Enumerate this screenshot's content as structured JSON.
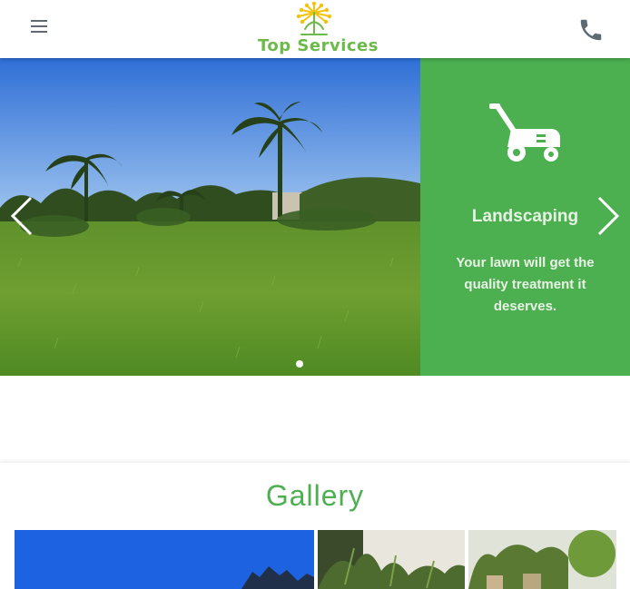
{
  "header": {
    "menu_icon": "hamburger-menu-icon",
    "phone_icon": "phone-icon",
    "logo_text": "Top Services"
  },
  "hero": {
    "slide": {
      "icon": "lawn-mower-icon",
      "title": "Landscaping",
      "description": "Your lawn will get the quality treatment it deserves."
    },
    "prev_icon": "chevron-left-icon",
    "next_icon": "chevron-right-icon",
    "slide_count": 1,
    "active_slide": 1
  },
  "gallery": {
    "title": "Gallery"
  },
  "colors": {
    "brand_green": "#4caf50",
    "logo_green": "#6cba4a",
    "logo_yellow": "#f2c20f",
    "icon_gray": "#5f6b73"
  }
}
